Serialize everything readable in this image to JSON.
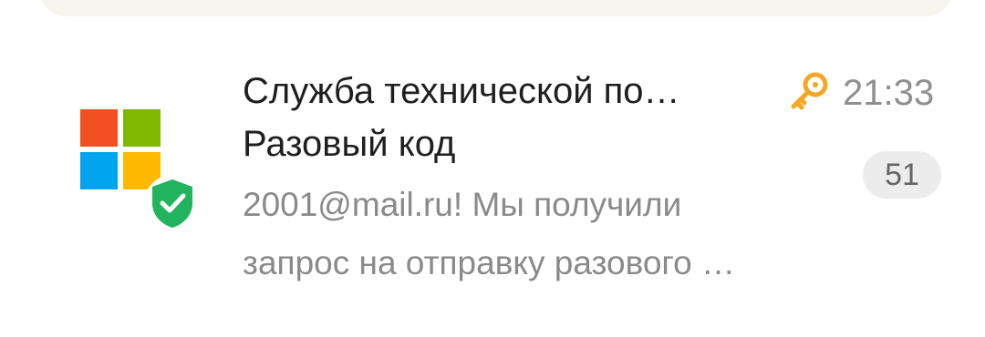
{
  "message": {
    "sender": "Служба технической по…",
    "subject": "Разовый код",
    "preview_line1": "2001@mail.ru! Мы получили",
    "preview_line2": "запрос на отправку разового …",
    "time": "21:33",
    "thread_count": "51"
  },
  "icons": {
    "avatar": "microsoft-logo",
    "badge": "shield-check-icon",
    "flag": "key-icon"
  },
  "colors": {
    "key_orange": "#f5a623",
    "shield_green": "#22b35e",
    "ms_red": "#f25022",
    "ms_green": "#7fba00",
    "ms_blue": "#00a4ef",
    "ms_yellow": "#ffb900"
  }
}
